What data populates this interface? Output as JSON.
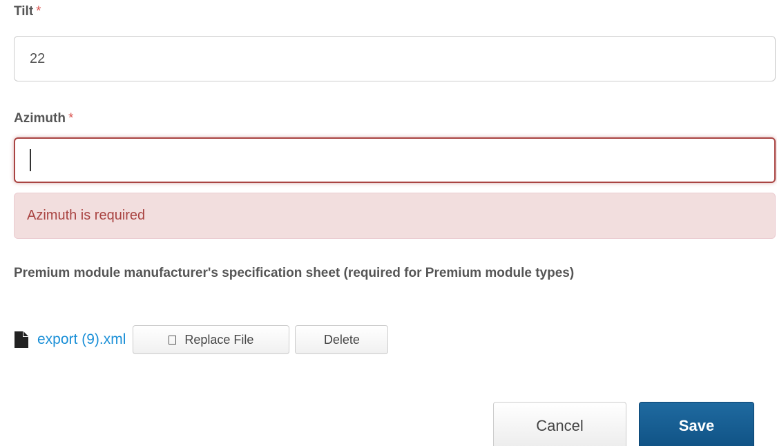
{
  "tilt": {
    "label": "Tilt",
    "required_mark": "*",
    "value": "22"
  },
  "azimuth": {
    "label": "Azimuth",
    "required_mark": "*",
    "value": "",
    "error": "Azimuth is required"
  },
  "spec_sheet": {
    "label": "Premium module manufacturer's specification sheet (required for Premium module types)",
    "file_name": "export (9).xml",
    "replace_label": "Replace File",
    "delete_label": "Delete"
  },
  "actions": {
    "cancel_label": "Cancel",
    "save_label": "Save"
  },
  "colors": {
    "required": "#d9534f",
    "error_text": "#a94442",
    "error_bg": "#f2dede",
    "link": "#1a8fd7",
    "primary": "#0d4e80"
  }
}
